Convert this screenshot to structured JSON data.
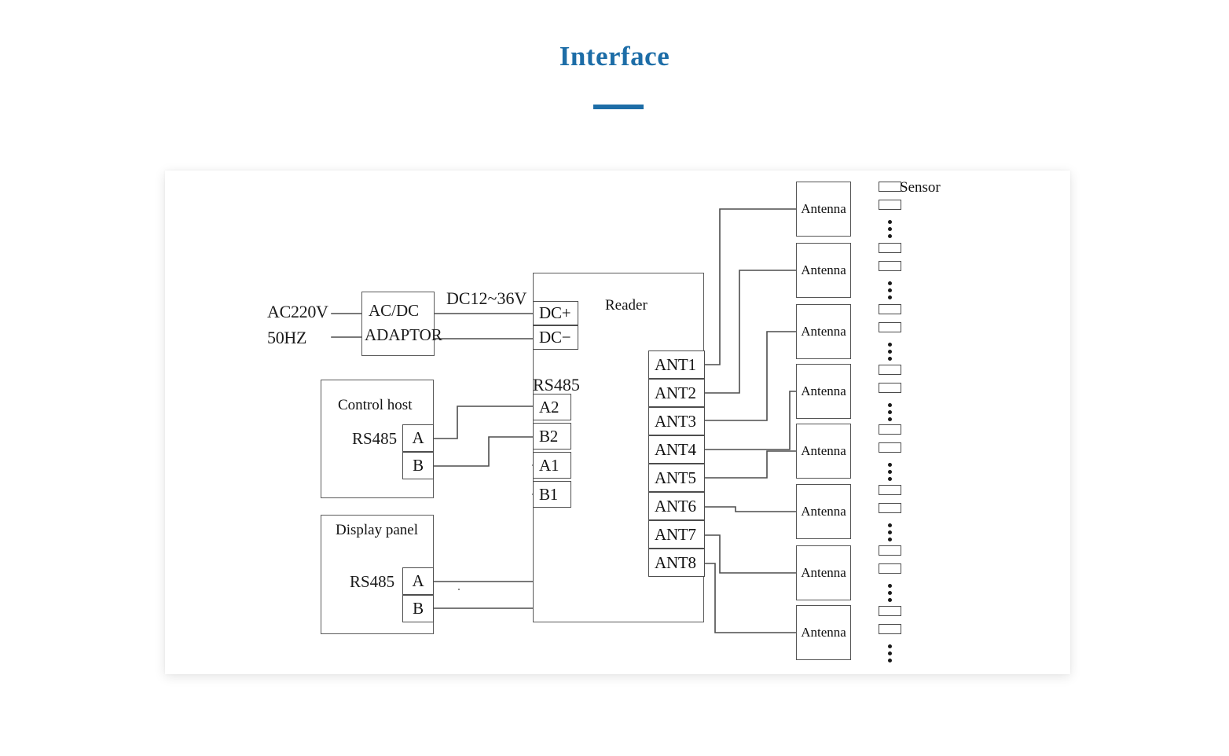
{
  "header": {
    "title": "Interface"
  },
  "diagram": {
    "type": "block-wiring-diagram",
    "power": {
      "source_line1": "AC220V",
      "source_line2": "50HZ",
      "adaptor_line1": "AC/DC",
      "adaptor_line2": "ADAPTOR",
      "output_label": "DC12~36V"
    },
    "reader": {
      "title": "Reader",
      "power_terminals": [
        "DC+",
        "DC−"
      ],
      "rs485_label": "RS485",
      "rs485_terminals": [
        "A2",
        "B2",
        "A1",
        "B1"
      ],
      "ant_terminals": [
        "ANT1",
        "ANT2",
        "ANT3",
        "ANT4",
        "ANT5",
        "ANT6",
        "ANT7",
        "ANT8"
      ]
    },
    "control_host": {
      "title": "Control host",
      "bus_label": "RS485",
      "terminals": [
        "A",
        "B"
      ]
    },
    "display_panel": {
      "title": "Display panel",
      "bus_label": "RS485",
      "terminals": [
        "A",
        "B"
      ]
    },
    "antennas": [
      {
        "label": "Antenna"
      },
      {
        "label": "Antenna"
      },
      {
        "label": "Antenna"
      },
      {
        "label": "Antenna"
      },
      {
        "label": "Antenna"
      },
      {
        "label": "Antenna"
      },
      {
        "label": "Antenna"
      },
      {
        "label": "Antenna"
      }
    ],
    "sensors": {
      "label": "Sensor",
      "group_count": 8,
      "rects_per_group": 2,
      "dots_per_group": 3
    },
    "connections": [
      {
        "from": "AC220V",
        "to": "AC/DC ADAPTOR"
      },
      {
        "from": "50HZ",
        "to": "AC/DC ADAPTOR"
      },
      {
        "from": "AC/DC ADAPTOR",
        "to": "DC+"
      },
      {
        "from": "AC/DC ADAPTOR",
        "to": "DC−"
      },
      {
        "from": "Control host A",
        "to": "A2"
      },
      {
        "from": "Control host B",
        "to": "B2"
      },
      {
        "from": "Display panel A",
        "to": "A1"
      },
      {
        "from": "Display panel B",
        "to": "B1"
      },
      {
        "from": "ANT1",
        "to": "Antenna 1"
      },
      {
        "from": "ANT2",
        "to": "Antenna 2"
      },
      {
        "from": "ANT3",
        "to": "Antenna 3"
      },
      {
        "from": "ANT4",
        "to": "Antenna 4"
      },
      {
        "from": "ANT5",
        "to": "Antenna 5"
      },
      {
        "from": "ANT6",
        "to": "Antenna 6"
      },
      {
        "from": "ANT7",
        "to": "Antenna 7"
      },
      {
        "from": "ANT8",
        "to": "Antenna 8"
      }
    ]
  },
  "colors": {
    "accent": "#1d6da7",
    "line": "#4d4d4d",
    "page_background": "#ffffff",
    "panel_background": "#ffffff",
    "text": "#111111"
  }
}
